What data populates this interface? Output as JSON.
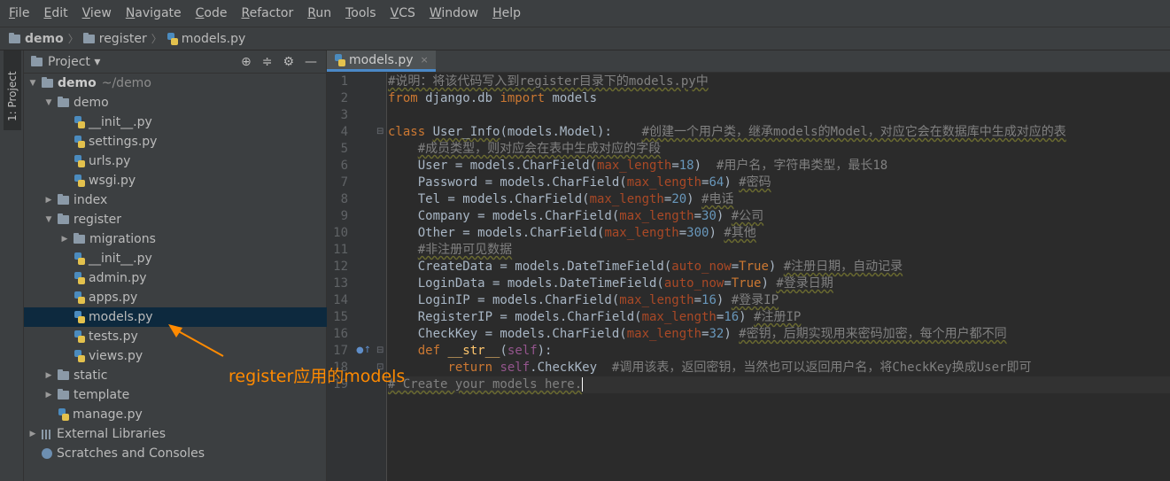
{
  "menu": [
    {
      "mnemonic": "F",
      "rest": "ile"
    },
    {
      "mnemonic": "E",
      "rest": "dit"
    },
    {
      "mnemonic": "V",
      "rest": "iew"
    },
    {
      "mnemonic": "N",
      "rest": "avigate"
    },
    {
      "mnemonic": "C",
      "rest": "ode"
    },
    {
      "mnemonic": "R",
      "rest": "efactor"
    },
    {
      "mnemonic": "R",
      "rest": "un"
    },
    {
      "mnemonic": "T",
      "rest": "ools"
    },
    {
      "mnemonic": "V",
      "rest": "CS"
    },
    {
      "mnemonic": "W",
      "rest": "indow"
    },
    {
      "mnemonic": "H",
      "rest": "elp"
    }
  ],
  "breadcrumb": [
    "demo",
    "register",
    "models.py"
  ],
  "sidebar_tab": "1: Project",
  "project_panel": {
    "title": "Project",
    "dropdown_glyph": "▾",
    "tools": [
      "⊕",
      "≑",
      "⚙",
      "—"
    ]
  },
  "tree": [
    {
      "label": "demo",
      "hint": "~/demo",
      "type": "folder",
      "indent": 0,
      "arrow": "▼",
      "bold": true
    },
    {
      "label": "demo",
      "type": "folder",
      "indent": 1,
      "arrow": "▼"
    },
    {
      "label": "__init__.py",
      "type": "py",
      "indent": 2
    },
    {
      "label": "settings.py",
      "type": "py",
      "indent": 2
    },
    {
      "label": "urls.py",
      "type": "py",
      "indent": 2
    },
    {
      "label": "wsgi.py",
      "type": "py",
      "indent": 2
    },
    {
      "label": "index",
      "type": "folder",
      "indent": 1,
      "arrow": "▶"
    },
    {
      "label": "register",
      "type": "folder",
      "indent": 1,
      "arrow": "▼"
    },
    {
      "label": "migrations",
      "type": "folder",
      "indent": 2,
      "arrow": "▶"
    },
    {
      "label": "__init__.py",
      "type": "py",
      "indent": 2
    },
    {
      "label": "admin.py",
      "type": "py",
      "indent": 2
    },
    {
      "label": "apps.py",
      "type": "py",
      "indent": 2
    },
    {
      "label": "models.py",
      "type": "py",
      "indent": 2,
      "selected": true
    },
    {
      "label": "tests.py",
      "type": "py",
      "indent": 2
    },
    {
      "label": "views.py",
      "type": "py",
      "indent": 2
    },
    {
      "label": "static",
      "type": "folder",
      "indent": 1,
      "arrow": "▶"
    },
    {
      "label": "template",
      "type": "folder",
      "indent": 1,
      "arrow": "▶"
    },
    {
      "label": "manage.py",
      "type": "py",
      "indent": 1
    },
    {
      "label": "External Libraries",
      "type": "lib",
      "indent": 0,
      "arrow": "▶"
    },
    {
      "label": "Scratches and Consoles",
      "type": "scratch",
      "indent": 0
    }
  ],
  "editor_tab": {
    "label": "models.py",
    "close": "×"
  },
  "annotation": "register应用的models",
  "code": [
    [
      [
        "#说明：将该代码写入到register目录下的models.py中",
        "cm wavy"
      ]
    ],
    [
      [
        "from",
        "kw"
      ],
      [
        " django.db ",
        ""
      ],
      [
        "import",
        "kw"
      ],
      [
        " models",
        ""
      ]
    ],
    [],
    [
      [
        "class",
        "kw"
      ],
      [
        " ",
        ""
      ],
      [
        "User_Info",
        "wavy"
      ],
      [
        "(models.Model):    ",
        ""
      ],
      [
        "#创建一个用户类，继承models的Model，对应它会在数据库中生成对应的表",
        "cm wavy"
      ]
    ],
    [
      [
        "    ",
        ""
      ],
      [
        "#成员类型，则对应会在表中生成对应的字段",
        "cm wavy"
      ]
    ],
    [
      [
        "    User = models.CharField(",
        ""
      ],
      [
        "max_length",
        "pm"
      ],
      [
        "=",
        ""
      ],
      [
        "18",
        "num"
      ],
      [
        ")  ",
        ""
      ],
      [
        "#用户名，字符串类型，最长18",
        "cm"
      ]
    ],
    [
      [
        "    Password = models.CharField(",
        ""
      ],
      [
        "max_length",
        "pm"
      ],
      [
        "=",
        ""
      ],
      [
        "64",
        "num"
      ],
      [
        ") ",
        ""
      ],
      [
        "#密码",
        "cm wavy"
      ]
    ],
    [
      [
        "    Tel = models.CharField(",
        ""
      ],
      [
        "max_length",
        "pm"
      ],
      [
        "=",
        ""
      ],
      [
        "20",
        "num"
      ],
      [
        ") ",
        ""
      ],
      [
        "#电话",
        "cm wavy"
      ]
    ],
    [
      [
        "    Company = models.CharField(",
        ""
      ],
      [
        "max_length",
        "pm"
      ],
      [
        "=",
        ""
      ],
      [
        "30",
        "num"
      ],
      [
        ") ",
        ""
      ],
      [
        "#公司",
        "cm wavy"
      ]
    ],
    [
      [
        "    Other = models.CharField(",
        ""
      ],
      [
        "max_length",
        "pm"
      ],
      [
        "=",
        ""
      ],
      [
        "300",
        "num"
      ],
      [
        ") ",
        ""
      ],
      [
        "#其他",
        "cm wavy"
      ]
    ],
    [
      [
        "    ",
        ""
      ],
      [
        "#非注册可见数据",
        "cm wavy"
      ]
    ],
    [
      [
        "    CreateData = models.DateTimeField(",
        ""
      ],
      [
        "auto_now",
        "pm"
      ],
      [
        "=",
        ""
      ],
      [
        "True",
        "kw"
      ],
      [
        ") ",
        ""
      ],
      [
        "#注册日期，自动记录",
        "cm wavy"
      ]
    ],
    [
      [
        "    LoginData = models.DateTimeField(",
        ""
      ],
      [
        "auto_now",
        "pm"
      ],
      [
        "=",
        ""
      ],
      [
        "True",
        "kw"
      ],
      [
        ") ",
        ""
      ],
      [
        "#登录日期",
        "cm wavy"
      ]
    ],
    [
      [
        "    LoginIP = models.CharField(",
        ""
      ],
      [
        "max_length",
        "pm"
      ],
      [
        "=",
        ""
      ],
      [
        "16",
        "num"
      ],
      [
        ") ",
        ""
      ],
      [
        "#登录IP",
        "cm wavy"
      ]
    ],
    [
      [
        "    RegisterIP = models.CharField(",
        ""
      ],
      [
        "max_length",
        "pm"
      ],
      [
        "=",
        ""
      ],
      [
        "16",
        "num"
      ],
      [
        ") ",
        ""
      ],
      [
        "#注册IP",
        "cm wavy"
      ]
    ],
    [
      [
        "    CheckKey = models.CharField(",
        ""
      ],
      [
        "max_length",
        "pm"
      ],
      [
        "=",
        ""
      ],
      [
        "32",
        "num"
      ],
      [
        ") ",
        ""
      ],
      [
        "#密钥，后期实现用来密码加密，每个用户都不同",
        "cm wavy"
      ]
    ],
    [
      [
        "    ",
        ""
      ],
      [
        "def",
        "kw"
      ],
      [
        " ",
        ""
      ],
      [
        "__str__",
        "fn"
      ],
      [
        "(",
        ""
      ],
      [
        "self",
        "slf"
      ],
      [
        "):",
        ""
      ]
    ],
    [
      [
        "        ",
        ""
      ],
      [
        "return",
        "kw"
      ],
      [
        " ",
        ""
      ],
      [
        "self",
        "slf"
      ],
      [
        ".CheckKey  ",
        ""
      ],
      [
        "#调用该表，返回密钥，当然也可以返回用户名，将CheckKey换成User即可",
        "cm"
      ]
    ],
    [
      [
        "# Create your models here.",
        "cm wavy"
      ],
      [
        "",
        ""
      ]
    ]
  ]
}
